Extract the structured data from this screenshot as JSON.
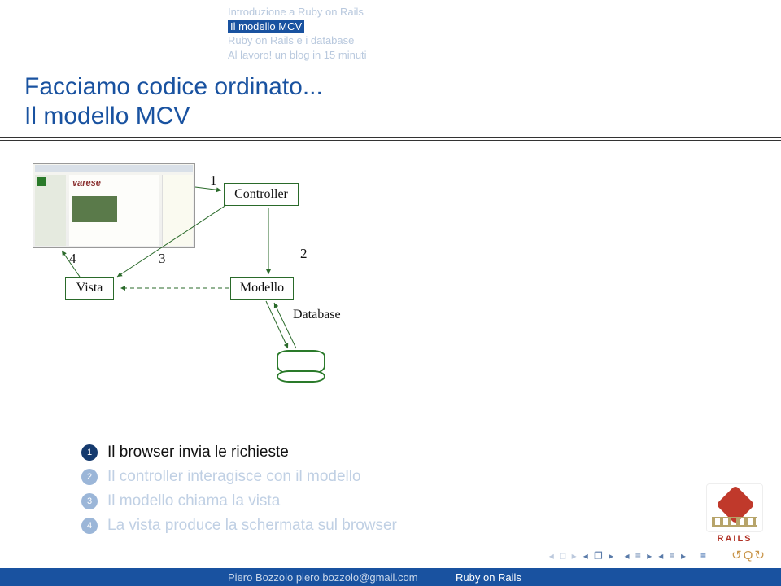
{
  "nav": {
    "line1": "Introduzione a Ruby on Rails",
    "line2": "Il modello MCV",
    "line3": "Ruby on Rails e i database",
    "line4": "Al lavoro! un blog in 15 minuti"
  },
  "title": {
    "line1": "Facciamo codice ordinato...",
    "line2": "Il modello MCV"
  },
  "diagram": {
    "controller": "Controller",
    "vista": "Vista",
    "modello": "Modello",
    "database": "Database",
    "thumb_brand": "varese",
    "n1": "1",
    "n2": "2",
    "n3": "3",
    "n4": "4"
  },
  "bullets": {
    "b1": "Il browser invia le richieste",
    "b2": "Il controller interagisce con il modello",
    "b3": "Il modello chiama la vista",
    "b4": "La vista produce la schermata sul browser"
  },
  "footer": {
    "author": "Piero Bozzolo piero.bozzolo@gmail.com",
    "talk": "Ruby on Rails"
  },
  "logo": {
    "text": "RAILS"
  }
}
